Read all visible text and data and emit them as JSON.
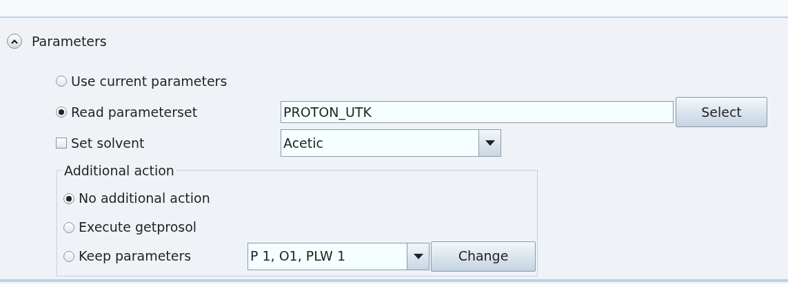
{
  "section": {
    "title": "Parameters",
    "expanded": true
  },
  "source_options": [
    {
      "kind": "radio",
      "label": "Use current parameters",
      "selected": false
    },
    {
      "kind": "radio",
      "label": "Read parameterset",
      "selected": true,
      "value": "PROTON_UTK",
      "button": "Select"
    },
    {
      "kind": "checkbox",
      "label": "Set solvent",
      "checked": false,
      "value": "Acetic"
    }
  ],
  "additional_action": {
    "title": "Additional action",
    "options": [
      {
        "label": "No additional action",
        "selected": true
      },
      {
        "label": "Execute getprosol",
        "selected": false
      },
      {
        "label": "Keep parameters",
        "selected": false,
        "value": "P 1, O1, PLW 1",
        "button": "Change"
      }
    ]
  }
}
